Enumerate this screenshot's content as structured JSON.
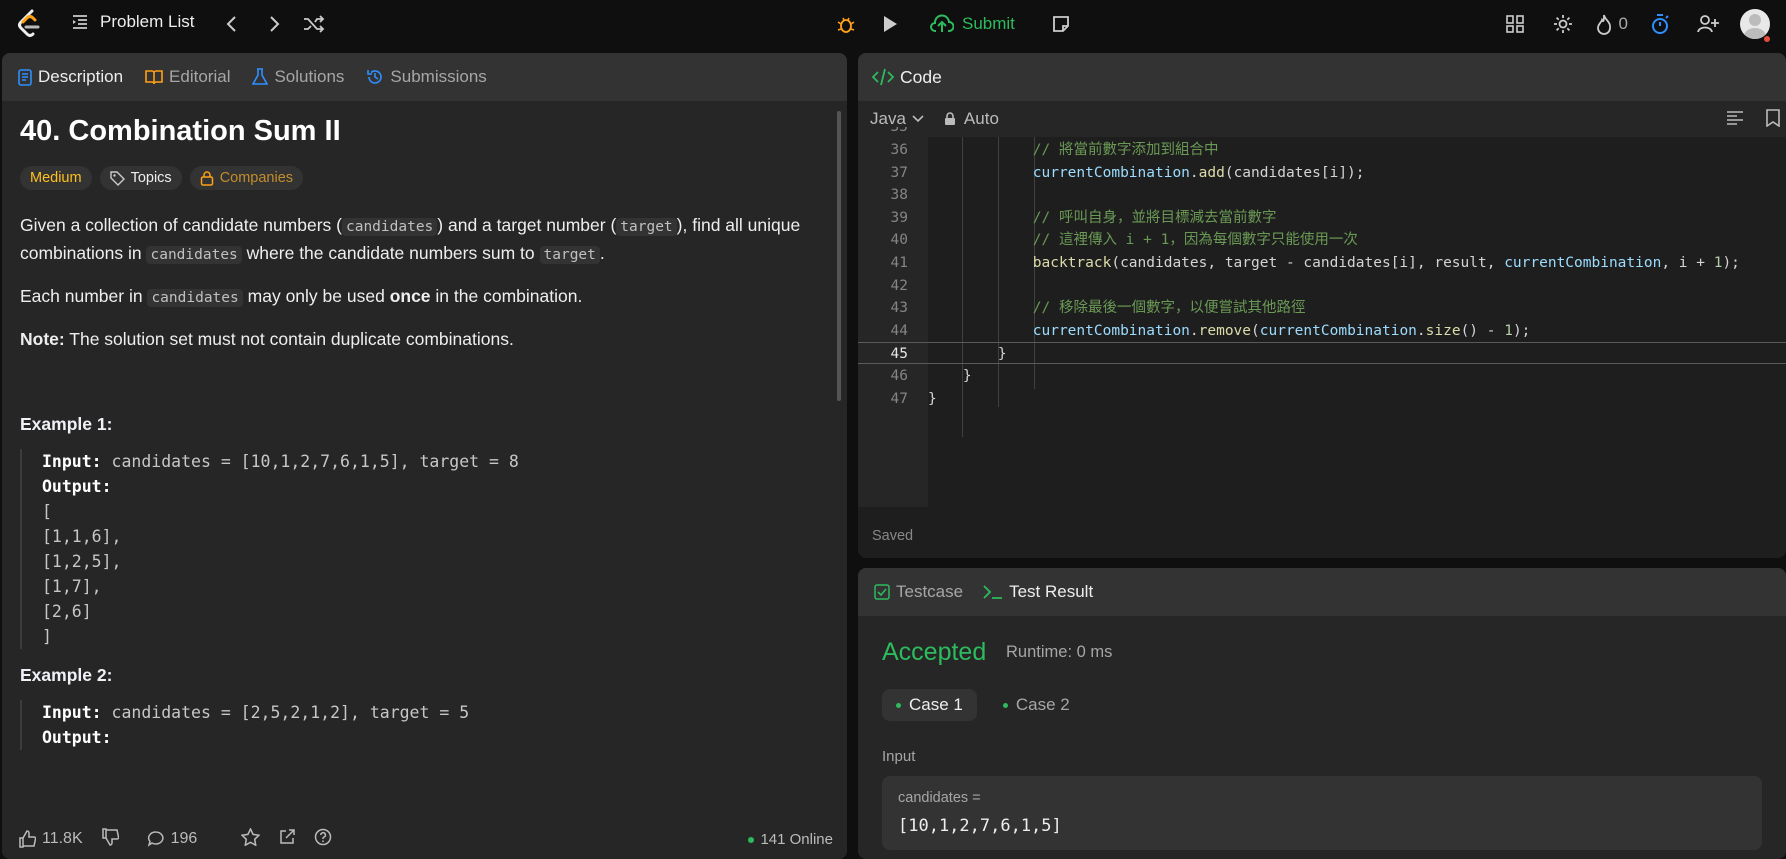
{
  "topbar": {
    "problem_list": "Problem List",
    "submit": "Submit",
    "streak": "0"
  },
  "tabs": {
    "description": "Description",
    "editorial": "Editorial",
    "solutions": "Solutions",
    "submissions": "Submissions"
  },
  "problem": {
    "title": "40. Combination Sum II",
    "difficulty": "Medium",
    "topics": "Topics",
    "companies": "Companies",
    "p1_a": "Given a collection of candidate numbers (",
    "p1_code1": "candidates",
    "p1_b": ") and a target number (",
    "p1_code2": "target",
    "p1_c": "), find all unique combinations in",
    "p1_code3": "candidates",
    "p1_d": "where the candidate numbers sum to",
    "p1_code4": "target",
    "p1_e": ".",
    "p2_a": "Each number in",
    "p2_code": "candidates",
    "p2_b": "may only be used",
    "p2_bold": "once",
    "p2_c": "in the combination.",
    "note_label": "Note:",
    "note_text": "The solution set must not contain duplicate combinations.",
    "example1_title": "Example 1:",
    "ex1_input_label": "Input:",
    "ex1_input": "candidates = [10,1,2,7,6,1,5], target = 8",
    "ex1_output_label": "Output:",
    "ex1_out": [
      "[",
      "[1,1,6],",
      "[1,2,5],",
      "[1,7],",
      "[2,6]",
      "]"
    ],
    "example2_title": "Example 2:",
    "ex2_input_label": "Input:",
    "ex2_input": "candidates = [2,5,2,1,2], target = 5",
    "ex2_output_label": "Output:"
  },
  "bottom": {
    "likes": "11.8K",
    "comments": "196",
    "online": "141 Online"
  },
  "code": {
    "header": "Code",
    "language": "Java",
    "mode": "Auto",
    "saved": "Saved",
    "lines": [
      {
        "n": "36",
        "t": "            // 將當前數字添加到組合中"
      },
      {
        "n": "37",
        "t": "            currentCombination.add(candidates[i]);"
      },
      {
        "n": "38",
        "t": ""
      },
      {
        "n": "39",
        "t": "            // 呼叫自身，並將目標減去當前數字"
      },
      {
        "n": "40",
        "t": "            // 這裡傳入 i + 1，因為每個數字只能使用一次"
      },
      {
        "n": "41",
        "t": "            backtrack(candidates, target - candidates[i], result, currentCombination, i + 1);"
      },
      {
        "n": "42",
        "t": ""
      },
      {
        "n": "43",
        "t": "            // 移除最後一個數字，以便嘗試其他路徑"
      },
      {
        "n": "44",
        "t": "            currentCombination.remove(currentCombination.size() - 1);"
      },
      {
        "n": "45",
        "t": "        }"
      },
      {
        "n": "46",
        "t": "    }"
      },
      {
        "n": "47",
        "t": "}"
      }
    ]
  },
  "test": {
    "testcase_tab": "Testcase",
    "result_tab": "Test Result",
    "status": "Accepted",
    "runtime": "Runtime: 0 ms",
    "case1": "Case 1",
    "case2": "Case 2",
    "input_label": "Input",
    "param_name": "candidates =",
    "param_value": "[10,1,2,7,6,1,5]"
  }
}
